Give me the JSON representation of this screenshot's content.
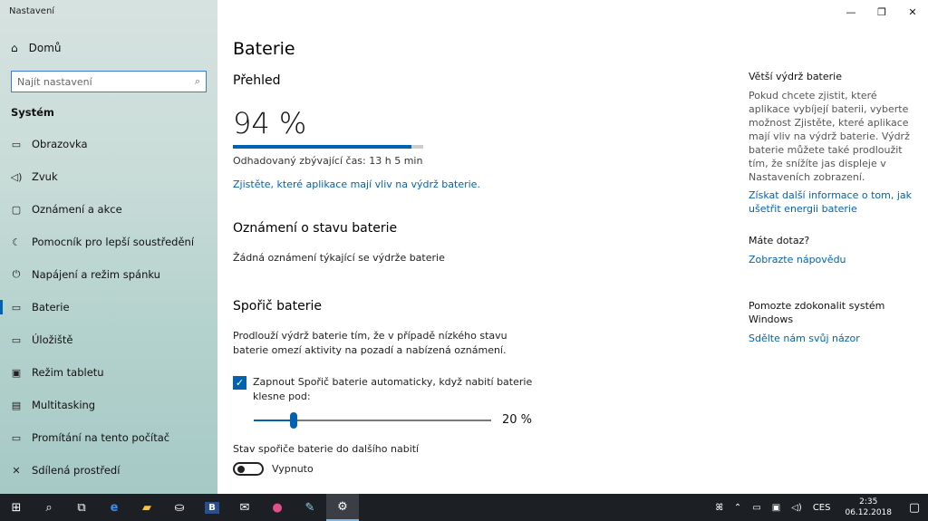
{
  "window": {
    "title": "Nastavení",
    "minimize": "—",
    "maximize": "❐",
    "close": "✕"
  },
  "sidebar": {
    "home_label": "Domů",
    "search_placeholder": "Najít nastavení",
    "section": "Systém",
    "items": [
      {
        "label": "Obrazovka",
        "icon": "display-icon",
        "glyph": "▭"
      },
      {
        "label": "Zvuk",
        "icon": "speaker-icon",
        "glyph": "◁)"
      },
      {
        "label": "Oznámení a akce",
        "icon": "notification-icon",
        "glyph": "▢"
      },
      {
        "label": "Pomocník pro lepší soustředění",
        "icon": "moon-icon",
        "glyph": "☾"
      },
      {
        "label": "Napájení a režim spánku",
        "icon": "power-icon",
        "glyph": "⏻"
      },
      {
        "label": "Baterie",
        "icon": "battery-icon",
        "glyph": "▭"
      },
      {
        "label": "Úložiště",
        "icon": "storage-icon",
        "glyph": "▭"
      },
      {
        "label": "Režim tabletu",
        "icon": "tablet-icon",
        "glyph": "▣"
      },
      {
        "label": "Multitasking",
        "icon": "multitasking-icon",
        "glyph": "▤"
      },
      {
        "label": "Promítání na tento počítač",
        "icon": "projecting-icon",
        "glyph": "▭"
      },
      {
        "label": "Sdílená prostředí",
        "icon": "shared-experiences-icon",
        "glyph": "✕"
      }
    ],
    "active_index": 5
  },
  "main": {
    "title": "Baterie",
    "overview": {
      "heading": "Přehled",
      "percent_text": "94 %",
      "percent_value": 94,
      "remaining": "Odhadovaný zbývající čas: 13 h 5 min",
      "apps_link": "Zjistěte, které aplikace mají vliv na výdrž baterie."
    },
    "notifications": {
      "heading": "Oznámení o stavu baterie",
      "text": "Žádná oznámení týkající se výdrže baterie"
    },
    "saver": {
      "heading": "Spořič baterie",
      "description": "Prodlouží výdrž baterie tím, že v případě nízkého stavu baterie omezí aktivity na pozadí a nabízená oznámení.",
      "auto_checkbox_label": "Zapnout Spořič baterie automaticky, když nabití baterie klesne pod:",
      "auto_checked": true,
      "threshold_value": 20,
      "threshold_text": "20 %",
      "state_label": "Stav spořiče baterie do dalšího nabití",
      "toggle_text": "Vypnuto",
      "toggle_on": false
    }
  },
  "right": {
    "longer_heading": "Větší výdrž baterie",
    "longer_text": "Pokud chcete zjistit, které aplikace vybíjejí baterii, vyberte možnost Zjistěte, které aplikace mají vliv na výdrž baterie. Výdrž baterie můžete také prodloužit tím, že snížíte jas displeje v Nastaveních zobrazení.",
    "longer_link": "Získat další informace o tom, jak ušetřit energii baterie",
    "question_heading": "Máte dotaz?",
    "question_link": "Zobrazte nápovědu",
    "improve_heading": "Pomozte zdokonalit systém Windows",
    "improve_link": "Sdělte nám svůj názor"
  },
  "taskbar": {
    "language": "CES",
    "time": "2:35",
    "date": "06.12.2018"
  },
  "colors": {
    "accent": "#0063b1",
    "taskbar": "#1c1f24"
  }
}
